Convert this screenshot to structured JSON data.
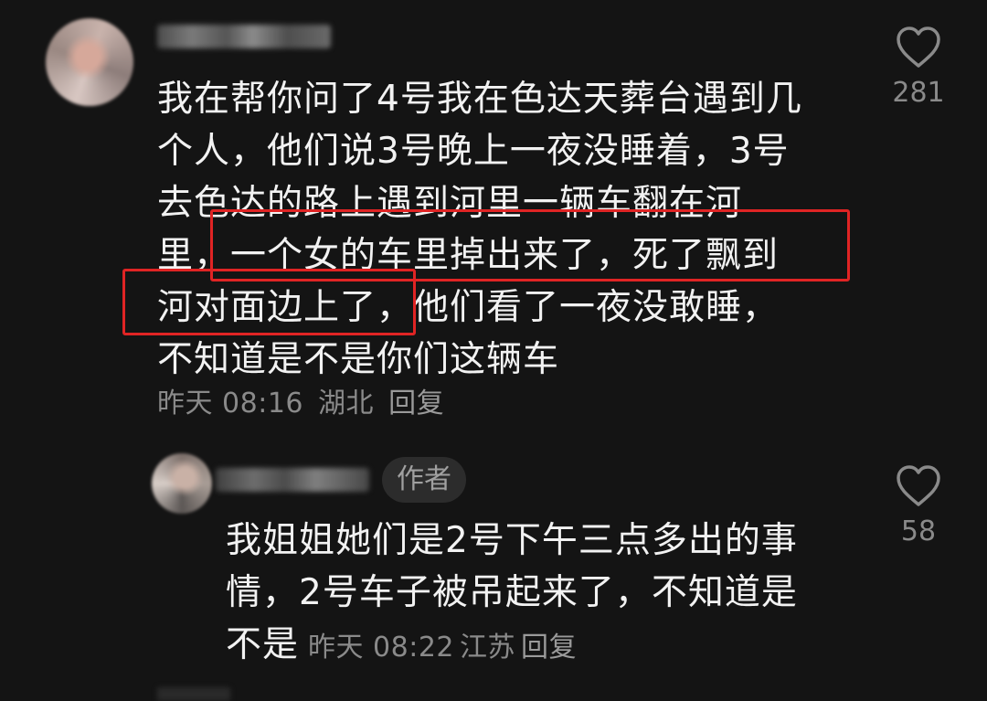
{
  "comment": {
    "text_lines": [
      "我在帮你问了4号我在色达天葬台遇到几",
      "个人，他们说3号晚上一夜没睡着，3号",
      "去色达的路上遇到河里一辆车翻在河",
      "里，一个女的车里掉出来了，死了飘到",
      "河对面边上了，他们看了一夜没敢睡，",
      "不知道是不是你们这辆车"
    ],
    "time": "昨天 08:16",
    "location": "湖北",
    "reply_label": "回复",
    "like_icon": "heart-outline-icon",
    "likes": "281"
  },
  "reply": {
    "author_badge": "作者",
    "text_lines": [
      "我姐姐她们是2号下午三点多出的事",
      "情，2号车子被吊起来了，不知道是",
      "不是"
    ],
    "time": "昨天 08:22",
    "location": "江苏",
    "reply_label": "回复",
    "like_icon": "heart-outline-icon",
    "likes": "58"
  },
  "colors": {
    "background": "#141414",
    "text": "#f2f2f2",
    "meta": "#8a8a8a",
    "highlight": "#e02424"
  }
}
